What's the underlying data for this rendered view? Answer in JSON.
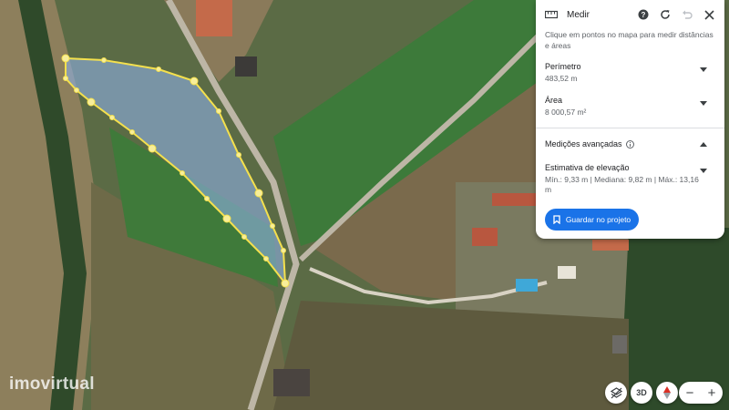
{
  "panel": {
    "title": "Medir",
    "instructions": "Clique em pontos no mapa para medir distâncias e áreas",
    "perimeter_label": "Perímetro",
    "perimeter_value": "483,52 m",
    "area_label": "Área",
    "area_value": "8 000,57 m²",
    "advanced_label": "Medições avançadas",
    "elevation_label": "Estimativa de elevação",
    "elevation_value": "Mín.: 9,33 m | Mediana: 9,82 m | Máx.: 13,16 m",
    "save_button": "Guardar no projeto"
  },
  "map": {
    "watermark": "imovirtual",
    "control_3d": "3D",
    "zoom_out": "−",
    "zoom_in": "+"
  },
  "colors": {
    "accent": "#1a73e8",
    "measure_line": "#f4e04d",
    "measure_fill": "#7fa8d8"
  }
}
